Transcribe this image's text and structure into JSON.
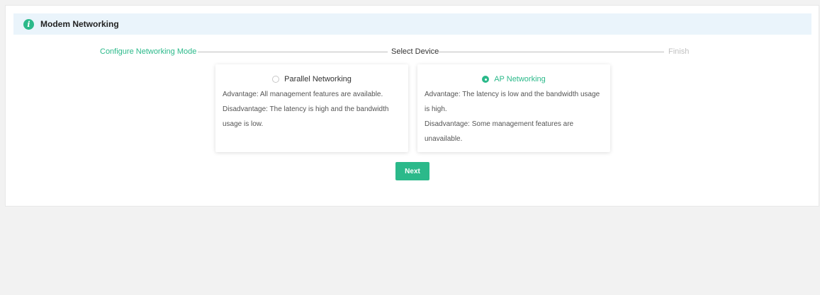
{
  "banner": {
    "icon": "info-icon",
    "title": "Modem Networking"
  },
  "steps": [
    {
      "label": "Configure Networking Mode",
      "state": "done"
    },
    {
      "label": "Select Device",
      "state": "current"
    },
    {
      "label": "Finish",
      "state": "pending"
    }
  ],
  "options": [
    {
      "title": "Parallel Networking",
      "selected": false,
      "advantage": "Advantage: All management features are available.",
      "disadvantage": "Disadvantage: The latency is high and the bandwidth usage is low."
    },
    {
      "title": "AP Networking",
      "selected": true,
      "advantage": "Advantage: The latency is low and the bandwidth usage is high.",
      "disadvantage": "Disadvantage: Some management features are unavailable."
    }
  ],
  "next_label": "Next",
  "colors": {
    "accent": "#2bb98a",
    "banner_bg": "#eaf4fb",
    "page_bg": "#f2f2f2",
    "pending": "#c0c0c0"
  }
}
